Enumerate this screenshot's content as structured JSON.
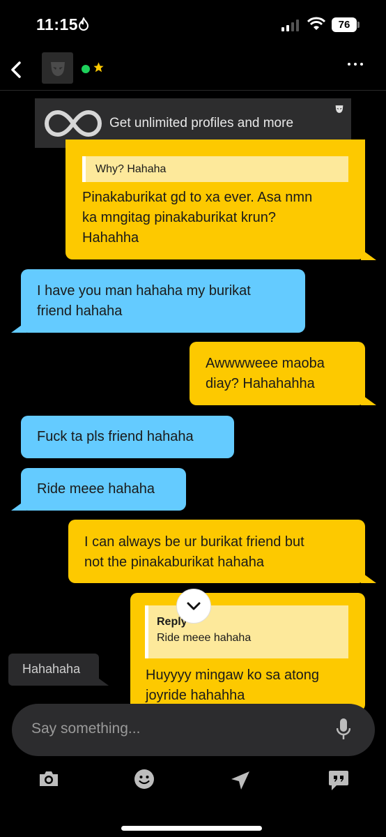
{
  "status_bar": {
    "time": "11:15",
    "battery": "76"
  },
  "banner": {
    "text": "Get unlimited profiles and more"
  },
  "messages": [
    {
      "reply_quote": "Why? Hahaha",
      "text": "Pinakaburikat gd to xa ever. Asa nmn\nka mngitag pinakaburikat krun?\nHahahha"
    },
    {
      "text": "I have you man hahaha my burikat\nfriend hahaha"
    },
    {
      "text": "Awwwweee maoba\ndiay? Hahahahha"
    },
    {
      "text": "Fuck ta pls friend hahaha"
    },
    {
      "text": "Ride meee hahaha"
    },
    {
      "text": "I can always be ur burikat friend but\nnot the pinakaburikat hahaha"
    },
    {
      "reply_label": "Reply",
      "reply_quote": "Ride meee hahaha",
      "text": "Huyyyy mingaw ko sa atong\njoyride hahahha"
    },
    {
      "text": "Hahahaha"
    }
  ],
  "composer": {
    "placeholder": "Say something..."
  },
  "colors": {
    "outgoing": "#fdc900",
    "incoming": "#64cbff",
    "online": "#1ed15c"
  },
  "icons": [
    "back-chevron-icon",
    "grindr-mask-icon",
    "star-icon",
    "more-icon",
    "infinity-icon",
    "chevron-down-icon",
    "microphone-icon",
    "camera-icon",
    "smiley-icon",
    "send-location-icon",
    "saved-phrases-icon"
  ]
}
